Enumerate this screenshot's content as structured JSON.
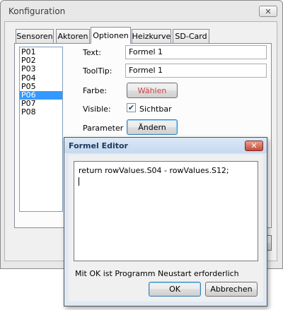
{
  "window": {
    "title": "Konfiguration",
    "close_symbol": "✕"
  },
  "tabs": [
    {
      "label": "Sensoren"
    },
    {
      "label": "Aktoren"
    },
    {
      "label": "Optionen",
      "active": true
    },
    {
      "label": "Heizkurve"
    },
    {
      "label": "SD-Card"
    }
  ],
  "list": {
    "items": [
      "P01",
      "P02",
      "P03",
      "P04",
      "P05",
      "P06",
      "P07",
      "P08"
    ],
    "selected": "P06"
  },
  "form": {
    "text_label": "Text:",
    "text_value": "Formel 1",
    "tooltip_label": "ToolTip:",
    "tooltip_value": "Formel 1",
    "farbe_label": "Farbe:",
    "farbe_button": "Wählen",
    "visible_label": "Visible:",
    "visible_checkbox_label": "Sichtbar",
    "visible_checked": true,
    "parameter_label": "Parameter",
    "parameter_button": "Ändern"
  },
  "dialog": {
    "title": "Formel Editor",
    "close_symbol": "✕",
    "formula": "return rowValues.S04 - rowValues.S12;",
    "hint": "Mit OK ist Programm Neustart erforderlich",
    "ok_button": "OK",
    "cancel_button": "Abbrechen"
  },
  "colors": {
    "selection": "#3399ff",
    "farbe_text": "#d04040"
  }
}
